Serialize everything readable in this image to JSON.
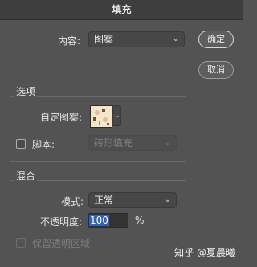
{
  "dialog": {
    "title": "填充"
  },
  "content": {
    "label": "内容:",
    "value": "图案"
  },
  "buttons": {
    "ok": "确定",
    "cancel": "取消"
  },
  "options": {
    "title": "选项",
    "custom_pattern_label": "自定图案:",
    "script_label": "脚本:",
    "script_value": "砖形填充"
  },
  "blending": {
    "title": "混合",
    "mode_label": "模式:",
    "mode_value": "正常",
    "opacity_label": "不透明度:",
    "opacity_value": "100",
    "opacity_unit": "%",
    "preserve_transparency_label": "保留透明区域"
  },
  "watermark": "知乎 @夏晨曦",
  "colors": {
    "dialog_bg": "#535353",
    "titlebar_bg": "#3e3e3e",
    "highlight": "#2f62b8"
  }
}
